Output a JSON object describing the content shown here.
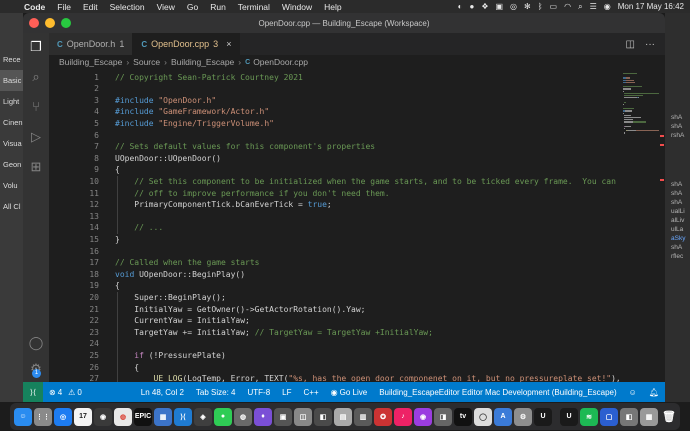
{
  "menubar": {
    "app": "Code",
    "items": [
      "File",
      "Edit",
      "Selection",
      "View",
      "Go",
      "Run",
      "Terminal",
      "Window",
      "Help"
    ],
    "datetime": "Mon 17 May 16:42"
  },
  "desktop_left": {
    "labels": [
      "Rece",
      "Basic",
      "Light",
      "Cinen",
      "Visua",
      "Geon",
      "Volu",
      "All Cl"
    ]
  },
  "desktop_right": {
    "labels": [
      "shA",
      "shA",
      "rshA",
      "shA",
      "shA",
      "shA",
      "ualLi",
      "alLiv",
      "ulLa",
      "aSky",
      "shA",
      "rflec"
    ]
  },
  "window": {
    "title": "OpenDoor.cpp — Building_Escape (Workspace)"
  },
  "tabs": [
    {
      "icon": "C",
      "name": "OpenDoor.h",
      "count": "1"
    },
    {
      "icon": "C",
      "name": "OpenDoor.cpp",
      "count": "3"
    }
  ],
  "breadcrumb": {
    "parts": [
      "Building_Escape",
      "Source",
      "Building_Escape"
    ],
    "file": "OpenDoor.cpp",
    "file_icon": "C"
  },
  "code": {
    "line_numbers": [
      "1",
      "2",
      "3",
      "4",
      "5",
      "6",
      "7",
      "8",
      "9",
      "10",
      "11",
      "12",
      "13",
      "14",
      "15",
      "16",
      "17",
      "18",
      "19",
      "20",
      "21",
      "22",
      "23",
      "24",
      "25",
      "26",
      "27"
    ],
    "lines": [
      [
        {
          "t": "// Copyright Sean-Patrick Courtney 2021",
          "c": "#6a9955"
        }
      ],
      [],
      [
        {
          "t": "#include ",
          "c": "#569cd6"
        },
        {
          "t": "\"OpenDoor.h\"",
          "c": "#ce9178"
        }
      ],
      [
        {
          "t": "#include ",
          "c": "#569cd6"
        },
        {
          "t": "\"GameFramework/Actor.h\"",
          "c": "#ce9178"
        }
      ],
      [
        {
          "t": "#include ",
          "c": "#569cd6"
        },
        {
          "t": "\"Engine/TriggerVolume.h\"",
          "c": "#ce9178"
        }
      ],
      [],
      [
        {
          "t": "// Sets default values for this component's properties",
          "c": "#6a9955"
        }
      ],
      [
        {
          "t": "UOpenDoor::UOpenDoor()",
          "c": "#d4d4d4"
        }
      ],
      [
        {
          "t": "{",
          "c": "#d4d4d4"
        }
      ],
      [
        {
          "t": "    // Set this component to be initialized when the game starts, and to be ticked every frame.  You can turn",
          "c": "#6a9955"
        }
      ],
      [
        {
          "t": "    // off to improve performance if you don't need them.",
          "c": "#6a9955"
        }
      ],
      [
        {
          "t": "    PrimaryComponentTick.bCanEverTick = ",
          "c": "#d4d4d4"
        },
        {
          "t": "true",
          "c": "#569cd6"
        },
        {
          "t": ";",
          "c": "#d4d4d4"
        }
      ],
      [],
      [
        {
          "t": "    // ...",
          "c": "#6a9955"
        }
      ],
      [
        {
          "t": "}",
          "c": "#d4d4d4"
        }
      ],
      [],
      [
        {
          "t": "// Called when the game starts",
          "c": "#6a9955"
        }
      ],
      [
        {
          "t": "void ",
          "c": "#569cd6"
        },
        {
          "t": "UOpenDoor::BeginPlay()",
          "c": "#d4d4d4"
        }
      ],
      [
        {
          "t": "{",
          "c": "#d4d4d4"
        }
      ],
      [
        {
          "t": "    Super::BeginPlay();",
          "c": "#d4d4d4"
        }
      ],
      [
        {
          "t": "    InitialYaw = GetOwner()->GetActorRotation().Yaw;",
          "c": "#d4d4d4"
        }
      ],
      [
        {
          "t": "    CurrentYaw = InitialYaw;",
          "c": "#d4d4d4"
        }
      ],
      [
        {
          "t": "    TargetYaw += InitialYaw; ",
          "c": "#d4d4d4"
        },
        {
          "t": "// TargetYaw = TargetYaw +InitialYaw;",
          "c": "#6a9955"
        }
      ],
      [],
      [
        {
          "t": "    ",
          "c": "#d4d4d4"
        },
        {
          "t": "if ",
          "c": "#c586c0"
        },
        {
          "t": "(!PressurePlate)",
          "c": "#d4d4d4"
        }
      ],
      [
        {
          "t": "    {",
          "c": "#d4d4d4"
        }
      ],
      [
        {
          "t": "        ",
          "c": "#d4d4d4"
        },
        {
          "t": "UE_LOG",
          "c": "#dcdcaa",
          "squiggle": true
        },
        {
          "t": "(LogTemp, Error, TEXT(",
          "c": "#d4d4d4"
        },
        {
          "t": "\"%s, has the open door componenet on it, but no pressureplate set!\"",
          "c": "#ce9178"
        },
        {
          "t": "), *Ge",
          "c": "#d4d4d4"
        }
      ],
      [
        {
          "t": "    }",
          "c": "#d4d4d4"
        }
      ]
    ]
  },
  "statusbar": {
    "errors": "4",
    "warnings": "0",
    "position": "Ln 48, Col 2",
    "tab_size": "Tab Size: 4",
    "encoding": "UTF-8",
    "eol": "LF",
    "language": "C++",
    "live": "Go Live",
    "config": "Building_EscapeEditor Editor Mac Development (Building_Escape)"
  },
  "dock": {
    "apps": [
      {
        "name": "finder",
        "color": "#2a8cf0",
        "glyph": "☺"
      },
      {
        "name": "launchpad",
        "color": "#8a8a8a",
        "glyph": "⋮⋮"
      },
      {
        "name": "safari",
        "color": "#1d7cf2",
        "glyph": "◎"
      },
      {
        "name": "calendar",
        "color": "#f4f4f4",
        "glyph": "17",
        "fg": "#222"
      },
      {
        "name": "app",
        "color": "#3a3a3a",
        "glyph": "◉"
      },
      {
        "name": "chrome",
        "color": "#e8e8e8",
        "glyph": "◍",
        "fg": "#db4437"
      },
      {
        "name": "epic-games",
        "color": "#111111",
        "glyph": "EPIC"
      },
      {
        "name": "notes",
        "color": "#3c74c9",
        "glyph": "▦"
      },
      {
        "name": "vscode",
        "color": "#1f7bd1",
        "glyph": "⟩⟨"
      },
      {
        "name": "app",
        "color": "#3f3f3f",
        "glyph": "◈"
      },
      {
        "name": "messages",
        "color": "#2fcc55",
        "glyph": "●"
      },
      {
        "name": "app",
        "color": "#6a6a6a",
        "glyph": "◍"
      },
      {
        "name": "app",
        "color": "#7a4fd6",
        "glyph": "♦"
      },
      {
        "name": "app",
        "color": "#555",
        "glyph": "▣"
      },
      {
        "name": "app",
        "color": "#888",
        "glyph": "◫"
      },
      {
        "name": "app",
        "color": "#4a4a4a",
        "glyph": "◧"
      },
      {
        "name": "app",
        "color": "#aaa",
        "glyph": "▤"
      },
      {
        "name": "app",
        "color": "#5a5a5a",
        "glyph": "▥"
      },
      {
        "name": "app",
        "color": "#c33",
        "glyph": "✪"
      },
      {
        "name": "app",
        "color": "#e26",
        "glyph": "♪"
      },
      {
        "name": "podcasts",
        "color": "#9b3de0",
        "glyph": "◉"
      },
      {
        "name": "app",
        "color": "#666",
        "glyph": "◨"
      },
      {
        "name": "tv",
        "color": "#111",
        "glyph": "tv"
      },
      {
        "name": "app",
        "color": "#ddd",
        "glyph": "◯",
        "fg": "#333"
      },
      {
        "name": "app",
        "color": "#3b7bd8",
        "glyph": "A"
      },
      {
        "name": "settings",
        "color": "#8e8e8e",
        "glyph": "⚙"
      },
      {
        "name": "unreal",
        "color": "#1a1a1a",
        "glyph": "U"
      },
      {
        "name": "unreal",
        "color": "#1a1a1a",
        "glyph": "U"
      },
      {
        "name": "spotify",
        "color": "#1db954",
        "glyph": "≋"
      },
      {
        "name": "app",
        "color": "#2b5fd0",
        "glyph": "▢"
      },
      {
        "name": "app",
        "color": "#777",
        "glyph": "◧"
      },
      {
        "name": "app",
        "color": "#999",
        "glyph": "▦"
      }
    ],
    "trash_glyph": "🗑"
  }
}
